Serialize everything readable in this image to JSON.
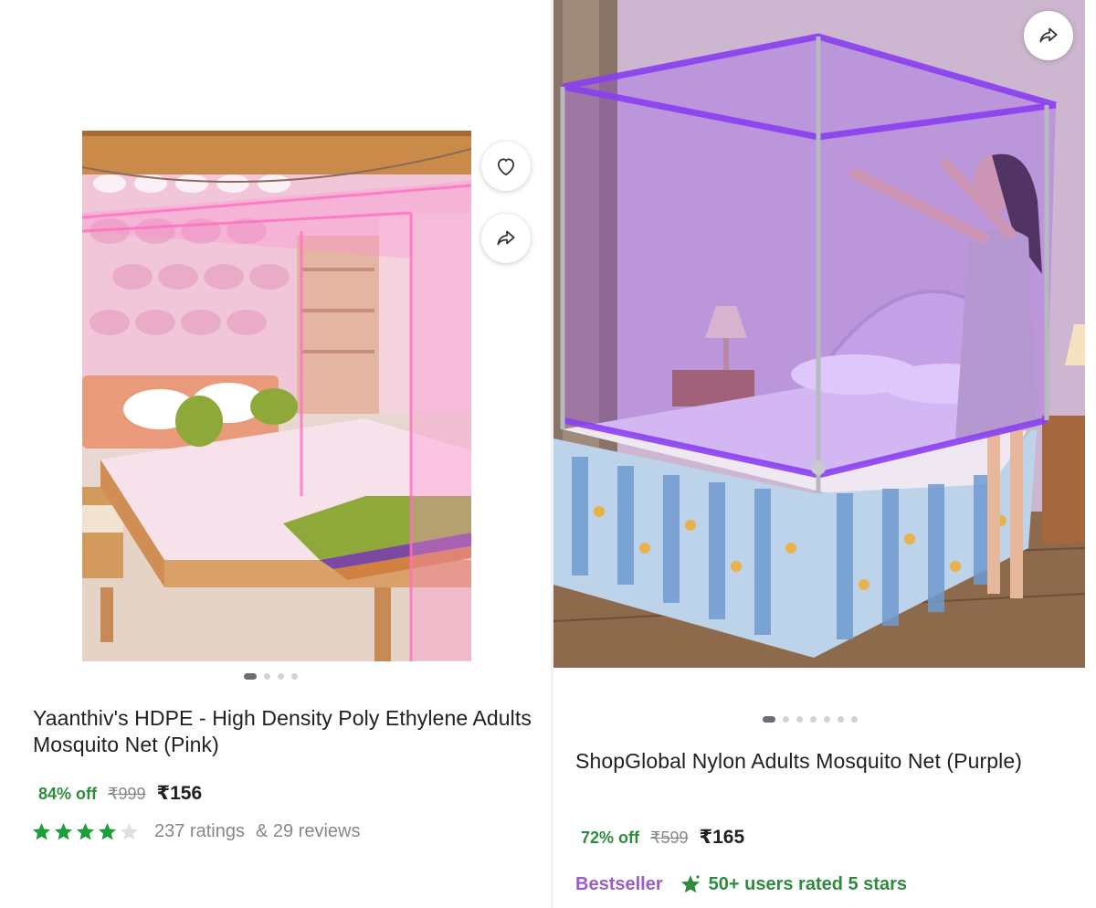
{
  "products": [
    {
      "title": "Yaanthiv's HDPE - High Density Poly Ethylene Adults Mosquito Net (Pink)",
      "discount": "84% off",
      "mrp": "₹999",
      "price": "₹156",
      "rating_stars": 4,
      "ratings_text": "237 ratings",
      "reviews_text": "& 29 reviews",
      "image_count": 4,
      "active_image": 0,
      "image_alt": "pink mosquito net over bed"
    },
    {
      "title": "ShopGlobal Nylon Adults Mosquito Net (Purple)",
      "discount": "72% off",
      "mrp": "₹599",
      "price": "₹165",
      "badge": "Bestseller",
      "rated_text": "50+ users rated 5 stars",
      "image_count": 7,
      "active_image": 0,
      "image_alt": "purple mosquito net over bed"
    }
  ],
  "icons": {
    "wishlist": "heart-icon",
    "share": "share-icon",
    "rating": "star-icon",
    "badge": "sparkle-star-icon"
  },
  "colors": {
    "discount_green": "#2e8b3d",
    "star_green": "#1f9d3c",
    "bestseller_purple": "#9c5dc9",
    "strike_grey": "#878787"
  }
}
